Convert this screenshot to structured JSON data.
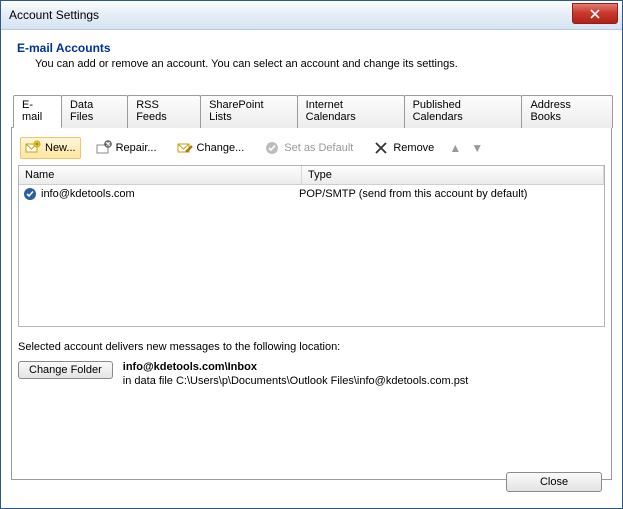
{
  "window": {
    "title": "Account Settings"
  },
  "header": {
    "title": "E-mail Accounts",
    "subtitle": "You can add or remove an account. You can select an account and change its settings."
  },
  "tabs": [
    {
      "id": "email",
      "label": "E-mail",
      "active": true
    },
    {
      "id": "datafiles",
      "label": "Data Files"
    },
    {
      "id": "rss",
      "label": "RSS Feeds"
    },
    {
      "id": "sharepoint",
      "label": "SharePoint Lists"
    },
    {
      "id": "ical",
      "label": "Internet Calendars"
    },
    {
      "id": "pubcal",
      "label": "Published Calendars"
    },
    {
      "id": "addr",
      "label": "Address Books"
    }
  ],
  "toolbar": {
    "new": "New...",
    "repair": "Repair...",
    "change": "Change...",
    "set_default": "Set as Default",
    "remove": "Remove"
  },
  "columns": {
    "name": "Name",
    "type": "Type"
  },
  "accounts": [
    {
      "name": "info@kdetools.com",
      "type": "POP/SMTP (send from this account by default)",
      "default": true
    }
  ],
  "delivery": {
    "caption": "Selected account delivers new messages to the following location:",
    "change_folder": "Change Folder",
    "location_bold": "info@kdetools.com\\Inbox",
    "location_sub": "in data file C:\\Users\\p\\Documents\\Outlook Files\\info@kdetools.com.pst"
  },
  "buttons": {
    "close": "Close"
  }
}
